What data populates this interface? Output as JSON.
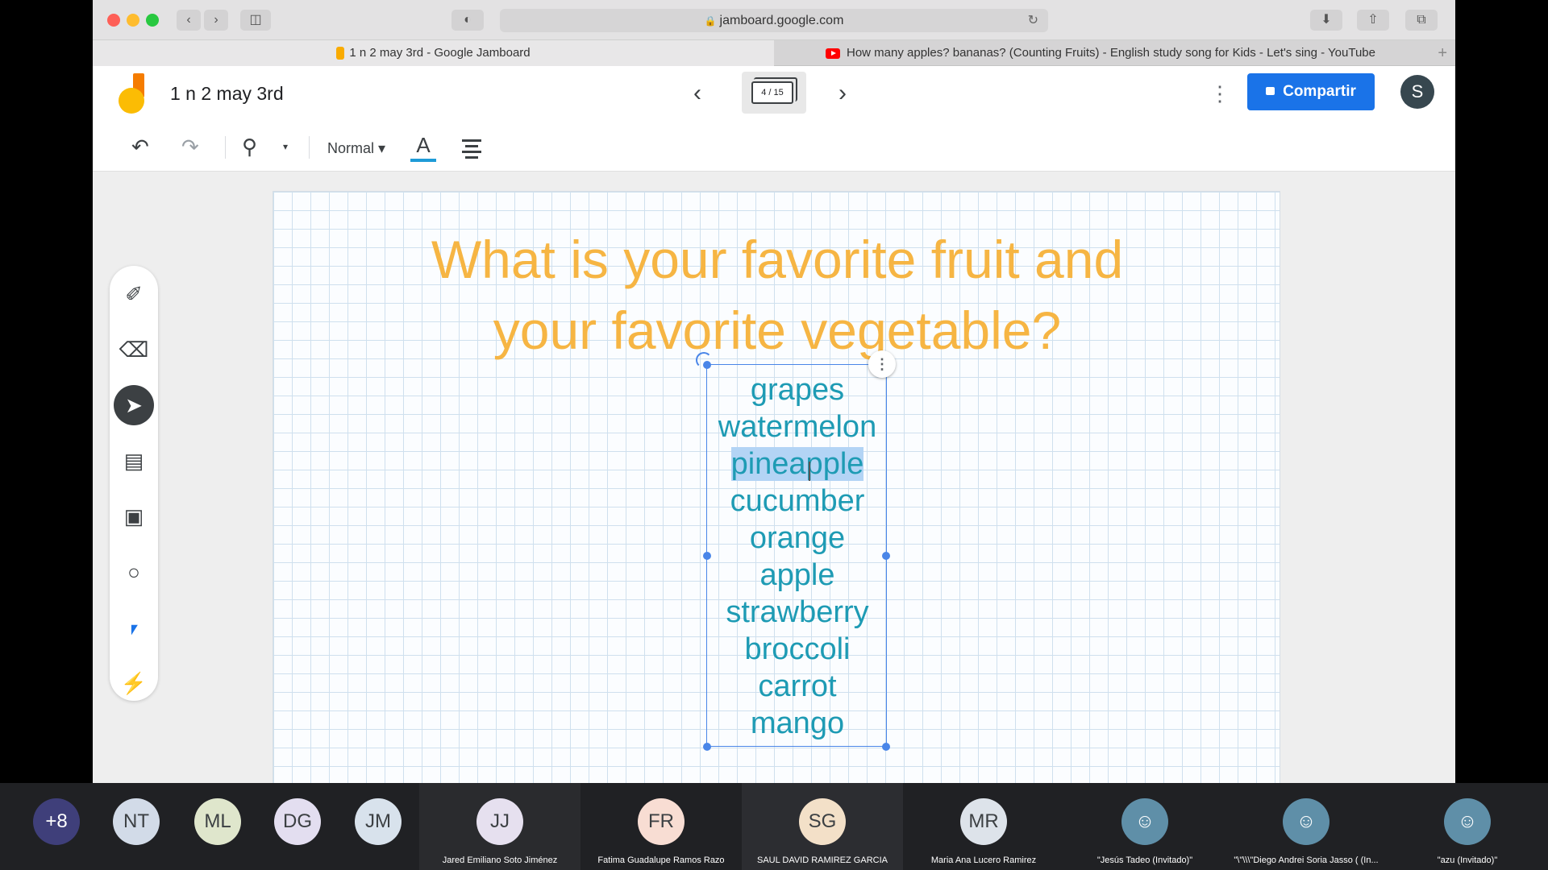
{
  "browser": {
    "url": "jamboard.google.com",
    "tabs": [
      {
        "title": "1 n 2 may 3rd - Google Jamboard"
      },
      {
        "title": "How many apples? bananas? (Counting Fruits) - English study song for Kids - Let's sing - YouTube"
      }
    ]
  },
  "app": {
    "doc_title": "1 n 2 may 3rd",
    "frame_indicator": "4 / 15",
    "share_label": "Compartir",
    "user_initial": "S"
  },
  "toolbar": {
    "text_style": "Normal"
  },
  "board": {
    "question_line1": "What is your favorite fruit and",
    "question_line2": "your favorite vegetable?",
    "words": [
      "grapes",
      "watermelon",
      "pineapple",
      "cucumber",
      "orange",
      "apple",
      "strawberry",
      "broccoli",
      "carrot",
      "mango"
    ],
    "selected_word": "pineapple"
  },
  "meeting": {
    "more_count": "+8",
    "participants": [
      {
        "initials": "NT"
      },
      {
        "initials": "ML"
      },
      {
        "initials": "DG"
      },
      {
        "initials": "JM"
      }
    ],
    "tiles": [
      {
        "initials": "JJ",
        "name": "Jared Emiliano Soto Jiménez"
      },
      {
        "initials": "FR",
        "name": "Fatima Guadalupe Ramos Razo"
      },
      {
        "initials": "SG",
        "name": "SAUL DAVID RAMIREZ GARCIA"
      },
      {
        "initials": "MR",
        "name": "Maria Ana Lucero Ramirez"
      },
      {
        "initials": "",
        "name": "\"Jesús Tadeo (Invitado)\""
      },
      {
        "initials": "",
        "name": "\"\\\"\\\\\\\"Diego Andrei Soria Jasso ( (In..."
      },
      {
        "initials": "",
        "name": "\"azu (Invitado)\""
      }
    ]
  },
  "colors": {
    "question": "#f6b543",
    "words": "#1e9bb4",
    "selection": "#4a86e8",
    "share": "#1a73e8"
  }
}
